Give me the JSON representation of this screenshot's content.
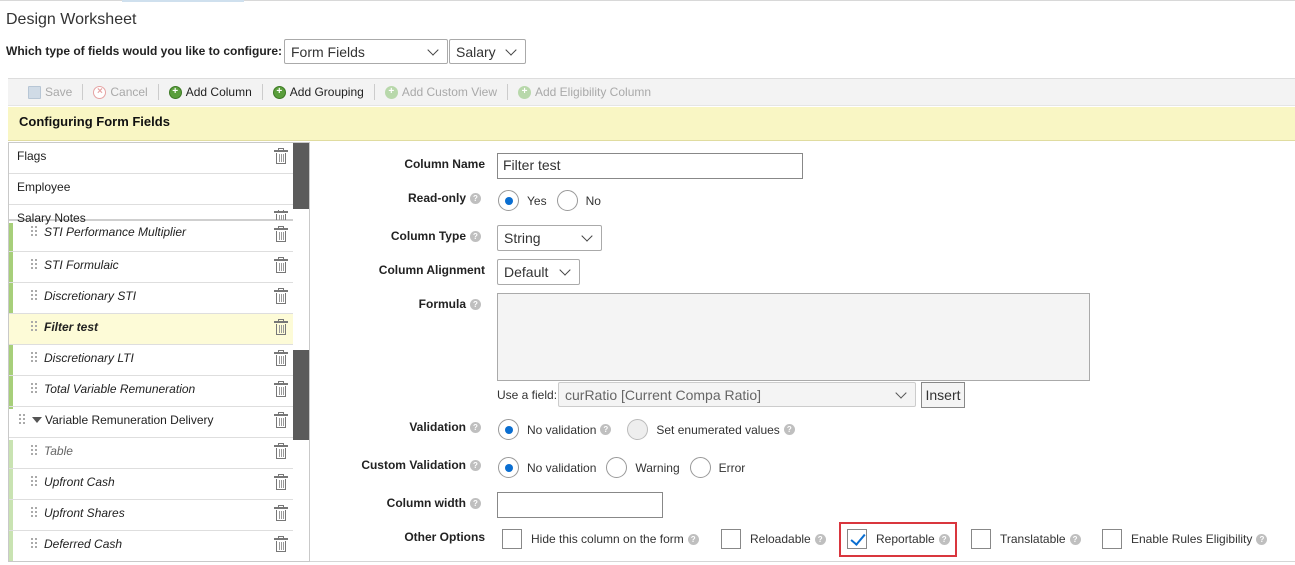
{
  "page": {
    "title": "Design Worksheet",
    "configure_label": "Which type of fields would you like to configure:",
    "field_type_select": "Form Fields",
    "field_subtype_select": "Salary"
  },
  "toolbar": {
    "save": "Save",
    "cancel": "Cancel",
    "add_column": "Add Column",
    "add_grouping": "Add Grouping",
    "add_custom_view": "Add Custom View",
    "add_eligibility_column": "Add Eligibility Column"
  },
  "banner": {
    "title": "Configuring Form Fields"
  },
  "left_list": {
    "top_items": [
      "Flags",
      "Employee",
      "Salary Notes"
    ],
    "items": [
      {
        "label": "STI Performance Multiplier"
      },
      {
        "label": "STI Formulaic"
      },
      {
        "label": "Discretionary STI"
      },
      {
        "label": "Filter test"
      },
      {
        "label": "Discretionary LTI"
      },
      {
        "label": "Total Variable Remuneration"
      },
      {
        "label": "Variable Remuneration Delivery"
      },
      {
        "label": "Table"
      },
      {
        "label": "Upfront Cash"
      },
      {
        "label": "Upfront Shares"
      },
      {
        "label": "Deferred Cash"
      }
    ]
  },
  "form": {
    "column_name_label": "Column Name",
    "column_name_value": "Filter test",
    "read_only_label": "Read-only",
    "read_only_yes": "Yes",
    "read_only_no": "No",
    "column_type_label": "Column Type",
    "column_type_value": "String",
    "column_alignment_label": "Column Alignment",
    "column_alignment_value": "Default",
    "formula_label": "Formula",
    "use_field_label": "Use a field:",
    "use_field_value": "curRatio [Current Compa Ratio]",
    "insert_button": "Insert",
    "validation_label": "Validation",
    "validation_none": "No validation",
    "validation_enum": "Set enumerated values",
    "custom_validation_label": "Custom Validation",
    "custom_validation_none": "No validation",
    "custom_validation_warning": "Warning",
    "custom_validation_error": "Error",
    "column_width_label": "Column width",
    "column_width_value": "",
    "other_options_label": "Other Options",
    "opt_hide": "Hide this column on the form",
    "opt_reloadable": "Reloadable",
    "opt_reportable": "Reportable",
    "opt_translatable": "Translatable",
    "opt_rules_eligibility": "Enable Rules Eligibility"
  },
  "colors": {
    "banner_bg": "#f9f6c4",
    "accent_blue": "#0a6ed1",
    "highlight_red": "#d9363e",
    "selected_row_bg": "#fdfbd7"
  },
  "icons": [
    "save-icon",
    "cancel-icon",
    "add-icon",
    "trash-icon",
    "grip-icon",
    "help-icon",
    "chevron-down-icon",
    "triangle-down-icon"
  ]
}
